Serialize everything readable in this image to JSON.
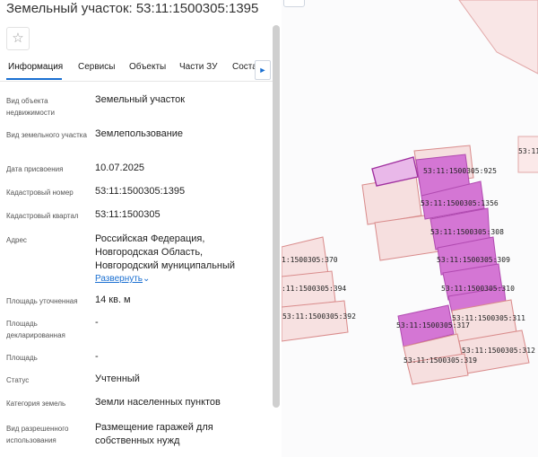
{
  "panel": {
    "title": "Земельный участок: 53:11:1500305:1395",
    "favorite_icon": "star-outline-icon",
    "tabs": [
      "Информация",
      "Сервисы",
      "Объекты",
      "Части ЗУ",
      "Соста"
    ],
    "active_tab": "Информация",
    "tabs_next_icon": "chevron-right-icon",
    "fields": [
      {
        "label": "Вид объекта недвижимости",
        "value": "Земельный участок"
      },
      {
        "label": "Вид земельного участка",
        "value": "Землепользование"
      },
      {
        "label": "Дата присвоения",
        "value": "10.07.2025"
      },
      {
        "label": "Кадастровый номер",
        "value": "53:11:1500305:1395"
      },
      {
        "label": "Кадастровый квартал",
        "value": "53:11:1500305"
      },
      {
        "label": "Адрес",
        "value": "Российская Федерация, Новгородская Область, Новгородский муниципальный"
      },
      {
        "label": "Площадь уточненная",
        "value": "14 кв. м"
      },
      {
        "label": "Площадь декларированная",
        "value": "-"
      },
      {
        "label": "Площадь",
        "value": "-"
      },
      {
        "label": "Статус",
        "value": "Учтенный"
      },
      {
        "label": "Категория земель",
        "value": "Земли населенных пунктов"
      },
      {
        "label": "Вид разрешенного использования",
        "value": "Размещение гаражей для собственных нужд"
      }
    ],
    "expand_link": "Развернуть",
    "expand_icon": "chevron-down-icon"
  },
  "map": {
    "colors": {
      "parcel_fill": "#f6dfdf",
      "parcel_stroke": "#d98b8b",
      "selected_fill": "#d476d4",
      "selected_stroke": "#a0309f"
    },
    "labels": [
      "53:11:1500305:925",
      "53:11:1500305:1356",
      "53:11:1500305:308",
      "53:11:1500305:309",
      "53:11:1500305:310",
      "53:11:1500305:311",
      "53:11:1500305:312",
      "53:11:1500305:317",
      "53:11:1500305:319",
      "1:1500305:370",
      ":11:1500305:394",
      "53:11:1500305:392",
      "53:11:"
    ]
  }
}
